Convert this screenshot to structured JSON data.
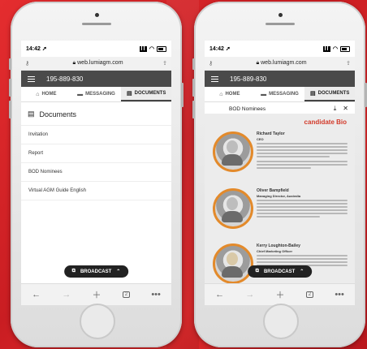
{
  "left_screen": {
    "status_time": "14:42",
    "url": "web.lumiagm.com",
    "meeting_id": "195-889-830",
    "tabs": [
      {
        "label": "HOME"
      },
      {
        "label": "MESSAGING"
      },
      {
        "label": "DOCUMENTS"
      }
    ],
    "documents_heading": "Documents",
    "documents": [
      {
        "label": "Invitation"
      },
      {
        "label": "Report"
      },
      {
        "label": "BOD Nominees"
      },
      {
        "label": "Virtual AGM Guide English"
      }
    ],
    "broadcast_label": "BROADCAST",
    "tab_count": "2"
  },
  "right_screen": {
    "status_time": "14:42",
    "url": "web.lumiagm.com",
    "meeting_id": "195-889-830",
    "tabs": [
      {
        "label": "HOME"
      },
      {
        "label": "MESSAGING"
      },
      {
        "label": "DOCUMENTS"
      }
    ],
    "viewer_title": "BOD Nominees",
    "pdf_heading": "candidate Bio",
    "candidates": [
      {
        "name": "Richard Taylor",
        "role": "CEO"
      },
      {
        "name": "Oliver Bampfield",
        "role": "Managing Director, Australia"
      },
      {
        "name": "Kerry Loughton-Bailey",
        "role": "Chief Marketing Officer"
      }
    ],
    "broadcast_label": "BROADCAST",
    "tab_count": "2"
  },
  "colors": {
    "background": "#d8232a",
    "app_bar": "#4a4a4a",
    "accent_heading": "#d23a2a",
    "avatar_ring": "#e38a2b"
  }
}
